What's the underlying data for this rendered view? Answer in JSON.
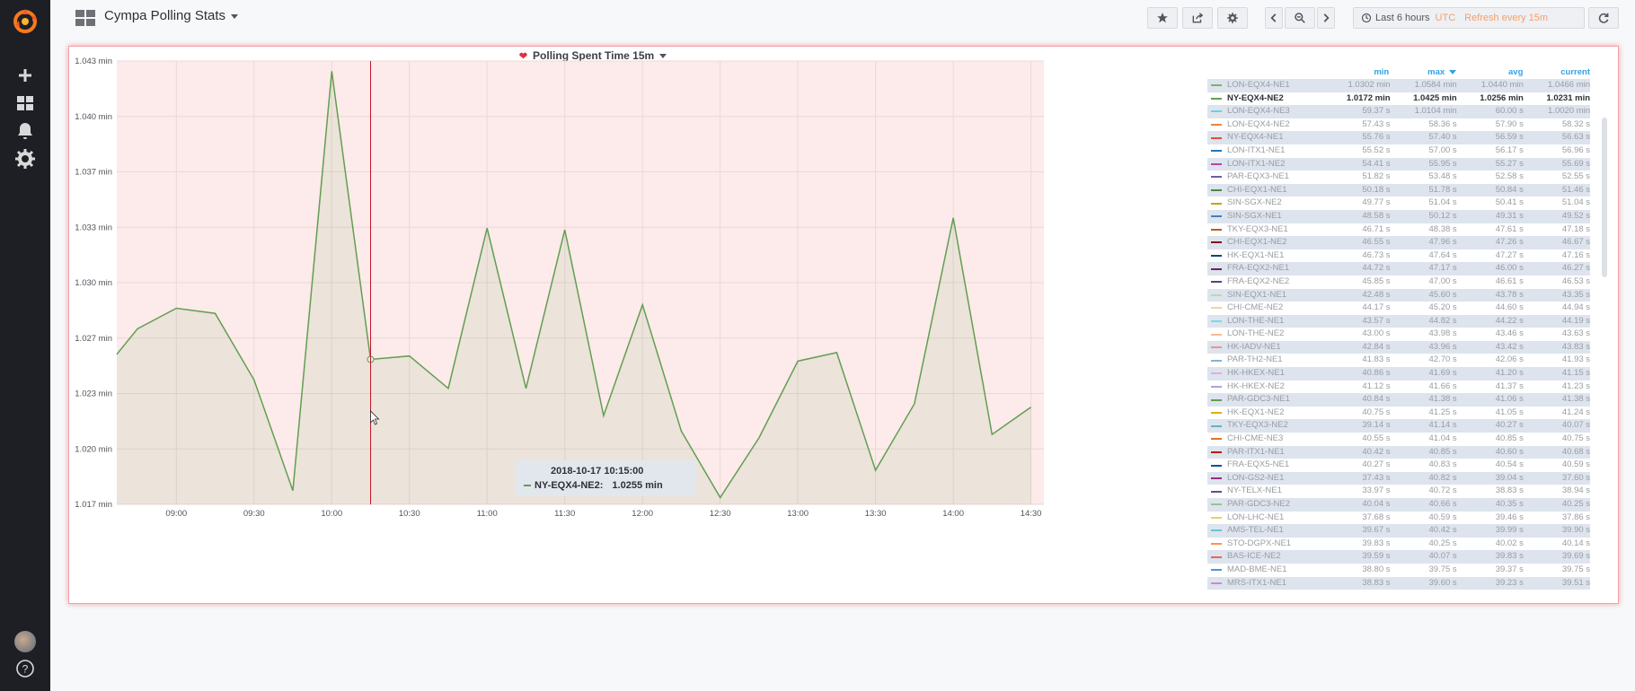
{
  "colors": {
    "sidebar": "#1e1f24",
    "accent_orange": "#f5a06a",
    "link_blue": "#33a2e5",
    "panel_alert_border": "#f3a0a6",
    "plot_background": "#fcebea",
    "series_green": "#629e51",
    "annotation_red": "#e02f44"
  },
  "sidebar": {
    "logo": "grafana-logo",
    "items": [
      "plus-icon",
      "dashboards-icon",
      "bell-icon",
      "gear-icon"
    ],
    "bottom": [
      "avatar",
      "help-icon"
    ]
  },
  "topbar": {
    "dashboard_title": "Cympa Polling Stats",
    "buttons": [
      "star-icon",
      "share-icon",
      "gear-icon",
      "chevron-left-icon",
      "zoom-out-icon",
      "chevron-right-icon",
      "refresh-icon"
    ],
    "time_range": "Last 6 hours",
    "timezone": "UTC",
    "refresh": "Refresh every 15m"
  },
  "panel": {
    "title": "Polling Spent Time 15m",
    "alert_state": "firing"
  },
  "chart_data": {
    "type": "line",
    "title": "Polling Spent Time 15m",
    "xlabel": "",
    "ylabel": "",
    "x_tick_labels": [
      "09:00",
      "09:30",
      "10:00",
      "10:30",
      "11:00",
      "11:30",
      "12:00",
      "12:30",
      "13:00",
      "13:30",
      "14:00",
      "14:30"
    ],
    "y_tick_labels": [
      "1.043 min",
      "1.040 min",
      "1.037 min",
      "1.033 min",
      "1.030 min",
      "1.027 min",
      "1.023 min",
      "1.020 min",
      "1.017 min"
    ],
    "ylim": [
      1.017,
      1.043
    ],
    "xlim": [
      "08:37",
      "14:35"
    ],
    "grid": true,
    "area_fill": true,
    "series": [
      {
        "name": "NY-EQX4-NE2",
        "color": "#629e51",
        "x": [
          "08:37",
          "08:45",
          "09:00",
          "09:15",
          "09:30",
          "09:45",
          "10:00",
          "10:15",
          "10:30",
          "10:45",
          "11:00",
          "11:15",
          "11:30",
          "11:45",
          "12:00",
          "12:15",
          "12:30",
          "12:45",
          "13:00",
          "13:15",
          "13:30",
          "13:45",
          "14:00",
          "14:15",
          "14:30"
        ],
        "values": [
          1.0258,
          1.0273,
          1.0285,
          1.0282,
          1.0243,
          1.0178,
          1.0424,
          1.0255,
          1.0257,
          1.0238,
          1.0332,
          1.0238,
          1.0331,
          1.0222,
          1.0287,
          1.0213,
          1.0174,
          1.0209,
          1.0254,
          1.0259,
          1.019,
          1.0229,
          1.0338,
          1.0211,
          1.0227
        ]
      }
    ],
    "cursor_time": "10:15",
    "legend_placement": "right",
    "legend_columns": [
      "min",
      "max",
      "avg",
      "current"
    ],
    "sorted_column": "max"
  },
  "tooltip": {
    "time": "2018-10-17 10:15:00",
    "series": "NY-EQX4-NE2:",
    "value": "1.0255 min"
  },
  "legend": {
    "headers": {
      "min": "min",
      "max": "max",
      "avg": "avg",
      "current": "current"
    },
    "rows": [
      {
        "name": "LON-EQX4-NE1",
        "color": "#7eb26d",
        "min": "1.0302 min",
        "max": "1.0584 min",
        "avg": "1.0440 min",
        "current": "1.0466 min",
        "state": "dim"
      },
      {
        "name": "NY-EQX4-NE2",
        "color": "#629e51",
        "min": "1.0172 min",
        "max": "1.0425 min",
        "avg": "1.0256 min",
        "current": "1.0231 min",
        "state": "active"
      },
      {
        "name": "LON-EQX4-NE3",
        "color": "#6ed0e0",
        "min": "59.37 s",
        "max": "1.0104 min",
        "avg": "60.00 s",
        "current": "1.0020 min",
        "state": "dim"
      },
      {
        "name": "LON-EQX4-NE2",
        "color": "#ef843c",
        "min": "57.43 s",
        "max": "58.36 s",
        "avg": "57.90 s",
        "current": "58.32 s",
        "state": "dim"
      },
      {
        "name": "NY-EQX4-NE1",
        "color": "#e24d42",
        "min": "55.76 s",
        "max": "57.40 s",
        "avg": "56.59 s",
        "current": "56.63 s",
        "state": "dim"
      },
      {
        "name": "LON-ITX1-NE1",
        "color": "#1f78c1",
        "min": "55.52 s",
        "max": "57.00 s",
        "avg": "56.17 s",
        "current": "56.96 s",
        "state": "dim"
      },
      {
        "name": "LON-ITX1-NE2",
        "color": "#ba43a9",
        "min": "54.41 s",
        "max": "55.95 s",
        "avg": "55.27 s",
        "current": "55.69 s",
        "state": "dim"
      },
      {
        "name": "PAR-EQX3-NE1",
        "color": "#705da0",
        "min": "51.82 s",
        "max": "53.48 s",
        "avg": "52.58 s",
        "current": "52.55 s",
        "state": "dim"
      },
      {
        "name": "CHI-EQX1-NE1",
        "color": "#508642",
        "min": "50.18 s",
        "max": "51.78 s",
        "avg": "50.84 s",
        "current": "51.46 s",
        "state": "dim"
      },
      {
        "name": "SIN-SGX-NE2",
        "color": "#cca300",
        "min": "49.77 s",
        "max": "51.04 s",
        "avg": "50.41 s",
        "current": "51.04 s",
        "state": "dim"
      },
      {
        "name": "SIN-SGX-NE1",
        "color": "#447ebc",
        "min": "48.58 s",
        "max": "50.12 s",
        "avg": "49.31 s",
        "current": "49.52 s",
        "state": "dim"
      },
      {
        "name": "TKY-EQX3-NE1",
        "color": "#c15c17",
        "min": "46.71 s",
        "max": "48.38 s",
        "avg": "47.61 s",
        "current": "47.18 s",
        "state": "dim"
      },
      {
        "name": "CHI-EQX1-NE2",
        "color": "#890f02",
        "min": "46.55 s",
        "max": "47.96 s",
        "avg": "47.26 s",
        "current": "46.67 s",
        "state": "dim"
      },
      {
        "name": "HK-EQX1-NE1",
        "color": "#0a437c",
        "min": "46.73 s",
        "max": "47.64 s",
        "avg": "47.27 s",
        "current": "47.16 s",
        "state": "dim"
      },
      {
        "name": "FRA-EQX2-NE1",
        "color": "#6d1f62",
        "min": "44.72 s",
        "max": "47.17 s",
        "avg": "46.00 s",
        "current": "46.27 s",
        "state": "dim"
      },
      {
        "name": "FRA-EQX2-NE2",
        "color": "#584477",
        "min": "45.85 s",
        "max": "47.00 s",
        "avg": "46.61 s",
        "current": "46.53 s",
        "state": "dim"
      },
      {
        "name": "SIN-EQX1-NE1",
        "color": "#b7dbab",
        "min": "42.48 s",
        "max": "45.60 s",
        "avg": "43.78 s",
        "current": "43.35 s",
        "state": "dim"
      },
      {
        "name": "CHI-CME-NE2",
        "color": "#f4d598",
        "min": "44.17 s",
        "max": "45.20 s",
        "avg": "44.60 s",
        "current": "44.94 s",
        "state": "dim"
      },
      {
        "name": "LON-THE-NE1",
        "color": "#70dbed",
        "min": "43.57 s",
        "max": "44.82 s",
        "avg": "44.22 s",
        "current": "44.19 s",
        "state": "dim"
      },
      {
        "name": "LON-THE-NE2",
        "color": "#f9ba8f",
        "min": "43.00 s",
        "max": "43.98 s",
        "avg": "43.46 s",
        "current": "43.63 s",
        "state": "dim"
      },
      {
        "name": "HK-IADV-NE1",
        "color": "#f29191",
        "min": "42.84 s",
        "max": "43.96 s",
        "avg": "43.42 s",
        "current": "43.83 s",
        "state": "dim"
      },
      {
        "name": "PAR-TH2-NE1",
        "color": "#82b5d8",
        "min": "41.83 s",
        "max": "42.70 s",
        "avg": "42.06 s",
        "current": "41.93 s",
        "state": "dim"
      },
      {
        "name": "HK-HKEX-NE1",
        "color": "#e5a8e2",
        "min": "40.86 s",
        "max": "41.69 s",
        "avg": "41.20 s",
        "current": "41.15 s",
        "state": "dim"
      },
      {
        "name": "HK-HKEX-NE2",
        "color": "#aea2e0",
        "min": "41.12 s",
        "max": "41.66 s",
        "avg": "41.37 s",
        "current": "41.23 s",
        "state": "dim"
      },
      {
        "name": "PAR-GDC3-NE1",
        "color": "#629e51",
        "min": "40.84 s",
        "max": "41.38 s",
        "avg": "41.06 s",
        "current": "41.38 s",
        "state": "dim"
      },
      {
        "name": "HK-EQX1-NE2",
        "color": "#e5ac0e",
        "min": "40.75 s",
        "max": "41.25 s",
        "avg": "41.05 s",
        "current": "41.24 s",
        "state": "dim"
      },
      {
        "name": "TKY-EQX3-NE2",
        "color": "#64b0c8",
        "min": "39.14 s",
        "max": "41.14 s",
        "avg": "40.27 s",
        "current": "40.07 s",
        "state": "dim"
      },
      {
        "name": "CHI-CME-NE3",
        "color": "#e0752d",
        "min": "40.55 s",
        "max": "41.04 s",
        "avg": "40.85 s",
        "current": "40.75 s",
        "state": "dim"
      },
      {
        "name": "PAR-ITX1-NE1",
        "color": "#bf1b00",
        "min": "40.42 s",
        "max": "40.85 s",
        "avg": "40.60 s",
        "current": "40.68 s",
        "state": "dim"
      },
      {
        "name": "FRA-EQX5-NE1",
        "color": "#0a50a1",
        "min": "40.27 s",
        "max": "40.83 s",
        "avg": "40.54 s",
        "current": "40.59 s",
        "state": "dim"
      },
      {
        "name": "LON-GS2-NE1",
        "color": "#962d82",
        "min": "37.43 s",
        "max": "40.82 s",
        "avg": "39.04 s",
        "current": "37.60 s",
        "state": "dim"
      },
      {
        "name": "NY-TELX-NE1",
        "color": "#614d93",
        "min": "33.97 s",
        "max": "40.72 s",
        "avg": "38.83 s",
        "current": "38.94 s",
        "state": "dim"
      },
      {
        "name": "PAR-GDC3-NE2",
        "color": "#9ac48a",
        "min": "40.04 s",
        "max": "40.66 s",
        "avg": "40.35 s",
        "current": "40.25 s",
        "state": "dim"
      },
      {
        "name": "LON-LHC-NE1",
        "color": "#f2c96d",
        "min": "37.68 s",
        "max": "40.59 s",
        "avg": "39.46 s",
        "current": "37.86 s",
        "state": "dim"
      },
      {
        "name": "AMS-TEL-NE1",
        "color": "#65c5db",
        "min": "39.67 s",
        "max": "40.42 s",
        "avg": "39.99 s",
        "current": "39.90 s",
        "state": "dim"
      },
      {
        "name": "STO-DGPX-NE1",
        "color": "#f9934e",
        "min": "39.83 s",
        "max": "40.25 s",
        "avg": "40.02 s",
        "current": "40.14 s",
        "state": "dim"
      },
      {
        "name": "BAS-ICE-NE2",
        "color": "#ea6460",
        "min": "39.59 s",
        "max": "40.07 s",
        "avg": "39.83 s",
        "current": "39.69 s",
        "state": "dim"
      },
      {
        "name": "MAD-BME-NE1",
        "color": "#5195ce",
        "min": "38.80 s",
        "max": "39.75 s",
        "avg": "39.37 s",
        "current": "39.75 s",
        "state": "dim"
      },
      {
        "name": "MRS-ITX1-NE1",
        "color": "#d683ce",
        "min": "38.83 s",
        "max": "39.60 s",
        "avg": "39.23 s",
        "current": "39.51 s",
        "state": "dim"
      }
    ]
  }
}
